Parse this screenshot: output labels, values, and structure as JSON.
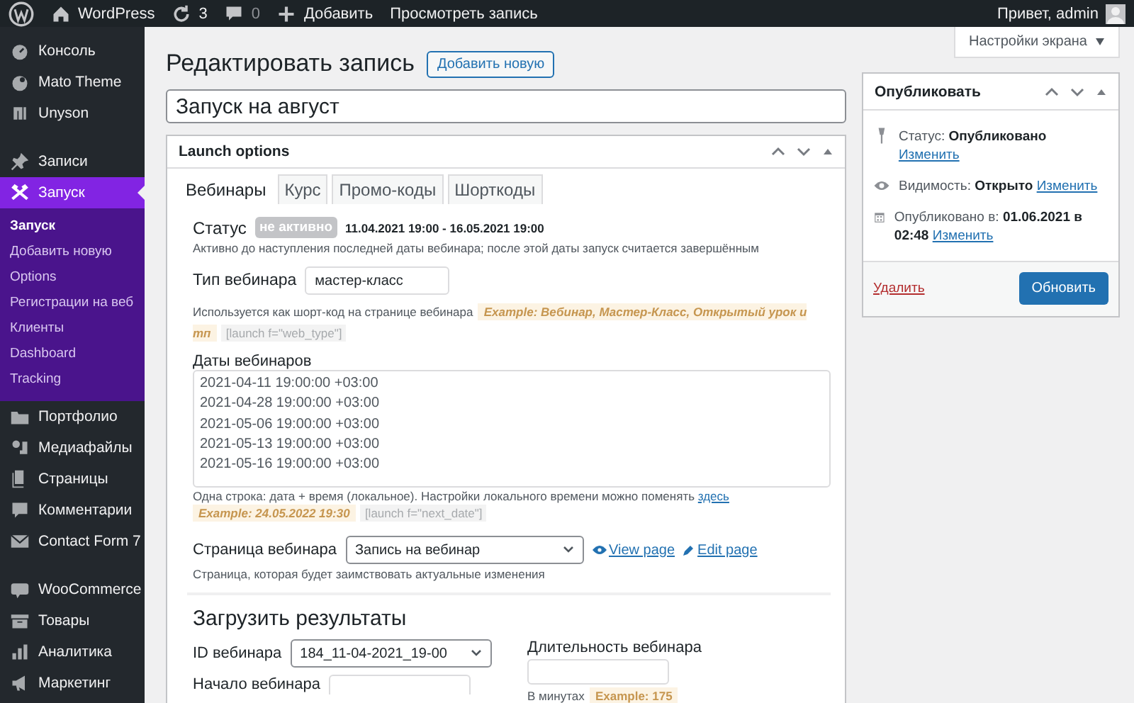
{
  "admin_bar": {
    "site": "WordPress",
    "updates": "3",
    "comments": "0",
    "new": "Добавить",
    "view": "Просмотреть запись",
    "greeting": "Привет, admin"
  },
  "screen_options": "Настройки экрана",
  "sidebar": {
    "groups": [
      {
        "items": [
          {
            "label": "Консоль",
            "selected": false
          },
          {
            "label": "Mato Theme",
            "selected": false
          },
          {
            "label": "Unyson",
            "selected": false
          }
        ]
      },
      {
        "items": [
          {
            "label": "Записи",
            "selected": false
          },
          {
            "label": "Запуск",
            "selected": true,
            "children": [
              {
                "label": "Запуск",
                "selected": true
              },
              {
                "label": "Добавить новую",
                "selected": false
              },
              {
                "label": "Options",
                "selected": false
              },
              {
                "label": "Регистрации на веб",
                "selected": false
              },
              {
                "label": "Клиенты",
                "selected": false
              },
              {
                "label": "Dashboard",
                "selected": false
              },
              {
                "label": "Tracking",
                "selected": false
              }
            ]
          },
          {
            "label": "Портфолио",
            "selected": false
          },
          {
            "label": "Медиафайлы",
            "selected": false
          },
          {
            "label": "Страницы",
            "selected": false
          },
          {
            "label": "Комментарии",
            "selected": false
          },
          {
            "label": "Contact Form 7",
            "selected": false
          }
        ]
      },
      {
        "items": [
          {
            "label": "WooCommerce",
            "selected": false
          },
          {
            "label": "Товары",
            "selected": false
          },
          {
            "label": "Аналитика",
            "selected": false
          },
          {
            "label": "Маркетинг",
            "selected": false
          }
        ]
      }
    ]
  },
  "page": {
    "title": "Редактировать запись",
    "add_new": "Добавить новую",
    "post_title": "Запуск на август"
  },
  "launch": {
    "title": "Launch options",
    "tabs": [
      {
        "label": "Вебинары",
        "selected": true
      },
      {
        "label": "Курс",
        "selected": false
      },
      {
        "label": "Промо-коды",
        "selected": false
      },
      {
        "label": "Шорткоды",
        "selected": false
      }
    ],
    "status": {
      "label": "Статус",
      "badge": "не активно",
      "active": false,
      "range": "11.04.2021 19:00 - 16.05.2021 19:00",
      "note": "Активно до наступления последней даты вебинара; после этой даты запуск считается завершённым"
    },
    "webinar_type": {
      "label": "Тип вебинара",
      "value": "мастер-класс",
      "help": "Используется как шорт-код на странице вебинара",
      "example": "Example: Вебинар, Мастер-Класс, Открытый урок и тп",
      "shortcode": "[launch f=\"web_type\"]"
    },
    "dates": {
      "label": "Даты вебинаров",
      "lines": [
        "2021-04-11 19:00:00 +03:00",
        "2021-04-28 19:00:00 +03:00",
        "2021-05-06 19:00:00 +03:00",
        "2021-05-13 19:00:00 +03:00",
        "2021-05-16 19:00:00 +03:00"
      ],
      "help": "Одна строка: дата + время (локальное). Настройки локального времени можно поменять",
      "link": "здесь",
      "example": "Example: 24.05.2022 19:30",
      "shortcode": "[launch f=\"next_date\"]"
    },
    "webinar_page": {
      "label": "Страница вебинара",
      "value": "Запись на вебинар",
      "view": "View page",
      "edit": "Edit page",
      "help": "Страница, которая будет заимствовать актуальные изменения"
    },
    "results": {
      "heading": "Загрузить результаты",
      "id_label": "ID вебинара",
      "id_value": "184_11-04-2021_19-00",
      "start_label": "Начало вебинара",
      "duration_label": "Длительность вебинара",
      "duration_help": "В минутах",
      "duration_example": "Example: 175"
    }
  },
  "publish": {
    "title": "Опубликовать",
    "rows": [
      {
        "label": "Статус:",
        "value": "Опубликовано",
        "link": "Изменить"
      },
      {
        "label": "Видимость:",
        "value": "Открыто",
        "link": "Изменить"
      },
      {
        "label": "Опубликовано в:",
        "value": "01.06.2021 в 02:48",
        "link": "Изменить"
      }
    ],
    "delete": "Удалить",
    "update": "Обновить"
  }
}
